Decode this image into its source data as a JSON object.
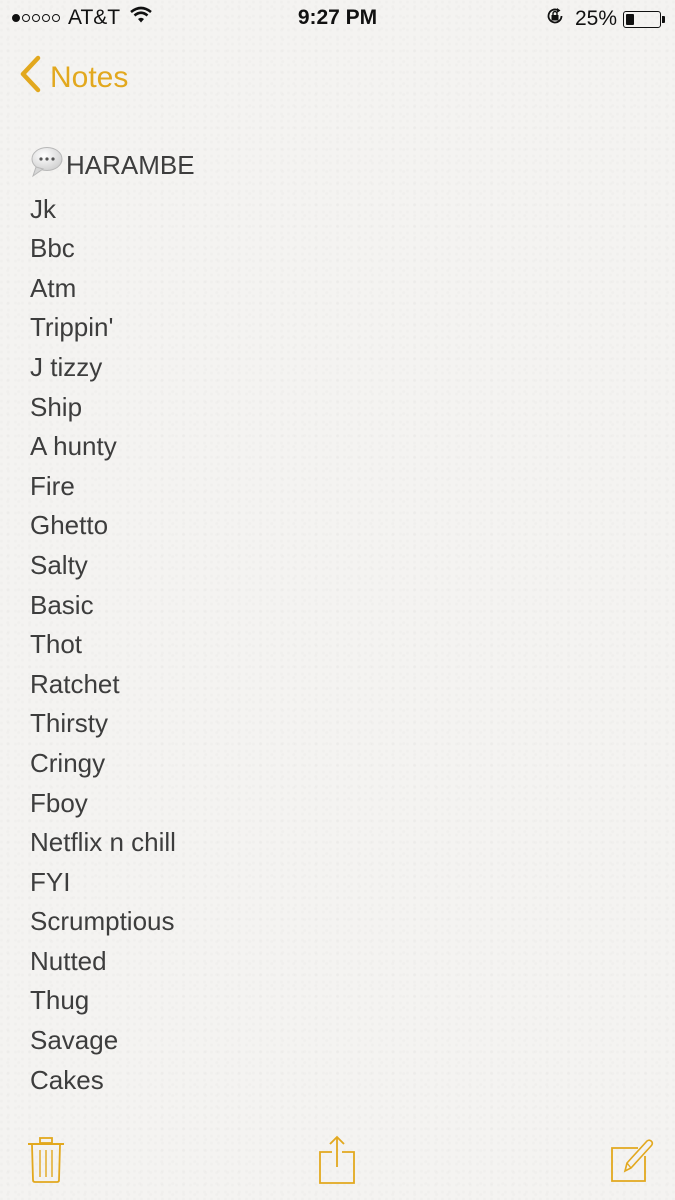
{
  "status_bar": {
    "signal_strength": "1 of 5",
    "carrier": "AT&T",
    "time": "9:27 PM",
    "battery_percent_label": "25%",
    "battery_level": 0.25,
    "icons": [
      "signal-dots-icon",
      "wifi-icon",
      "rotation-lock-icon",
      "battery-icon"
    ]
  },
  "nav": {
    "back_label": "Notes",
    "accent_color": "#e2a81e"
  },
  "note": {
    "first_line_emoji": "speech-bubble-icon",
    "lines": [
      "HARAMBE",
      "Jk",
      "Bbc",
      "Atm",
      "Trippin'",
      "J tizzy",
      "Ship",
      "A hunty",
      "Fire",
      "Ghetto",
      "Salty",
      "Basic",
      "Thot",
      "Ratchet",
      "Thirsty",
      "Cringy",
      "Fboy",
      "Netflix n chill",
      "FYI",
      "Scrumptious",
      "Nutted",
      "Thug",
      "Savage",
      "Cakes"
    ]
  },
  "toolbar": {
    "buttons": [
      "trash-icon",
      "share-icon",
      "compose-icon"
    ]
  }
}
